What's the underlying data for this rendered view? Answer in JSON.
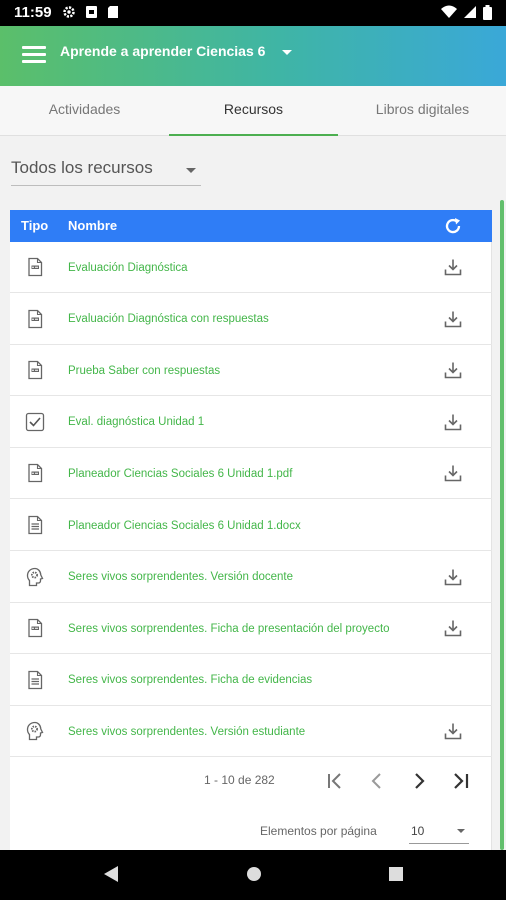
{
  "status": {
    "time": "11:59"
  },
  "appbar": {
    "title": "Aprende a aprender Ciencias 6"
  },
  "tabs": [
    {
      "label": "Actividades"
    },
    {
      "label": "Recursos"
    },
    {
      "label": "Libros digitales"
    }
  ],
  "filter": {
    "value": "Todos los recursos"
  },
  "table": {
    "col_tipo": "Tipo",
    "col_nombre": "Nombre",
    "rows": [
      {
        "name": "Evaluación Diagnóstica",
        "type_icon": "pdf-file-icon",
        "download": true
      },
      {
        "name": "Evaluación Diagnóstica con respuestas",
        "type_icon": "pdf-file-icon",
        "download": true
      },
      {
        "name": "Prueba Saber con respuestas",
        "type_icon": "pdf-file-icon",
        "download": true
      },
      {
        "name": "Eval. diagnóstica Unidad 1",
        "type_icon": "checkbox-icon",
        "download": true
      },
      {
        "name": "Planeador Ciencias Sociales 6 Unidad 1.pdf",
        "type_icon": "pdf-file-icon",
        "download": true
      },
      {
        "name": "Planeador Ciencias Sociales 6 Unidad 1.docx",
        "type_icon": "doc-file-icon",
        "download": false
      },
      {
        "name": "Seres vivos sorprendentes. Versión docente",
        "type_icon": "head-gear-icon",
        "download": true
      },
      {
        "name": "Seres vivos sorprendentes. Ficha de presentación del proyecto",
        "type_icon": "pdf-file-icon",
        "download": true
      },
      {
        "name": "Seres vivos sorprendentes. Ficha de evidencias",
        "type_icon": "doc-file-icon",
        "download": false
      },
      {
        "name": "Seres vivos sorprendentes. Versión estudiante",
        "type_icon": "head-gear-icon",
        "download": true
      }
    ]
  },
  "pagination": {
    "range": "1 - 10 de 282",
    "per_page_label": "Elementos por página",
    "per_page_value": "10"
  },
  "colors": {
    "accent_green": "#43b649",
    "header_blue": "#2f7df6"
  }
}
